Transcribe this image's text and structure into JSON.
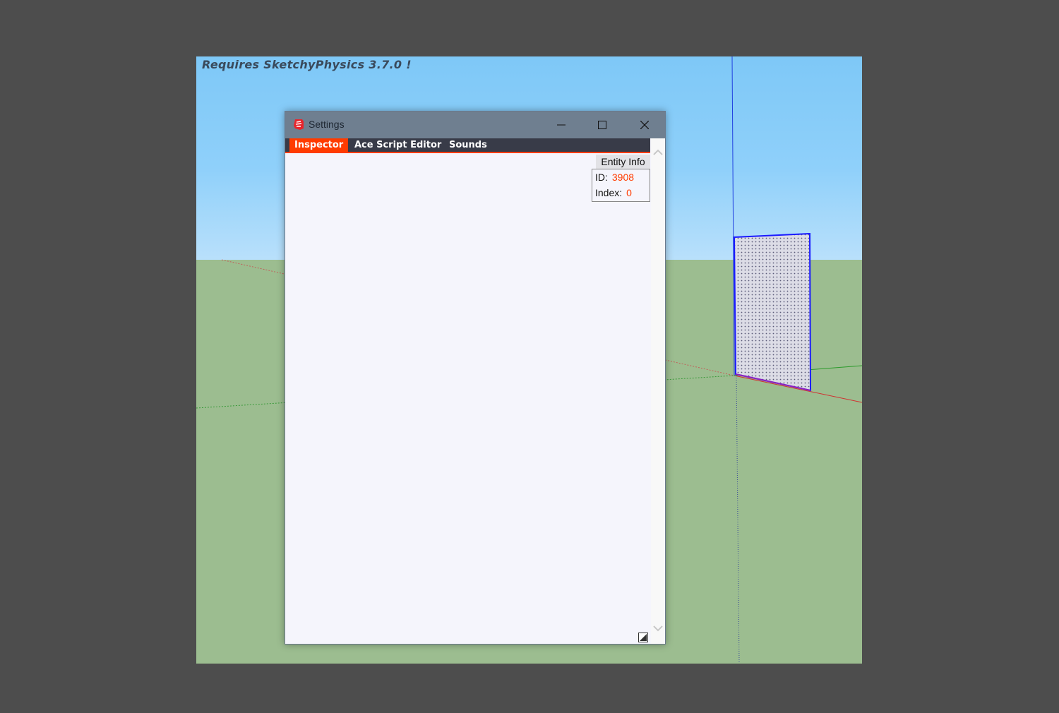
{
  "viewport": {
    "note": "Requires SketchyPhysics 3.7.0 !",
    "sky_color": "#7ec8f7",
    "ground_color": "#9cbd90"
  },
  "window": {
    "title": "Settings",
    "icon": "sketchup-logo-icon",
    "controls": [
      "minimize-icon",
      "maximize-icon",
      "close-icon"
    ]
  },
  "tabs": [
    {
      "label": "Inspector",
      "active": true
    },
    {
      "label": "Ace Script Editor",
      "active": false
    },
    {
      "label": "Sounds",
      "active": false
    }
  ],
  "entity_info": {
    "title": "Entity Info",
    "id_label": "ID:",
    "id_value": "3908",
    "index_label": "Index:",
    "index_value": "0"
  },
  "colors": {
    "accent": "#ff3b00",
    "tabbar": "#383b48",
    "titlebar": "#6f7f90",
    "content": "#f5f5fc"
  }
}
